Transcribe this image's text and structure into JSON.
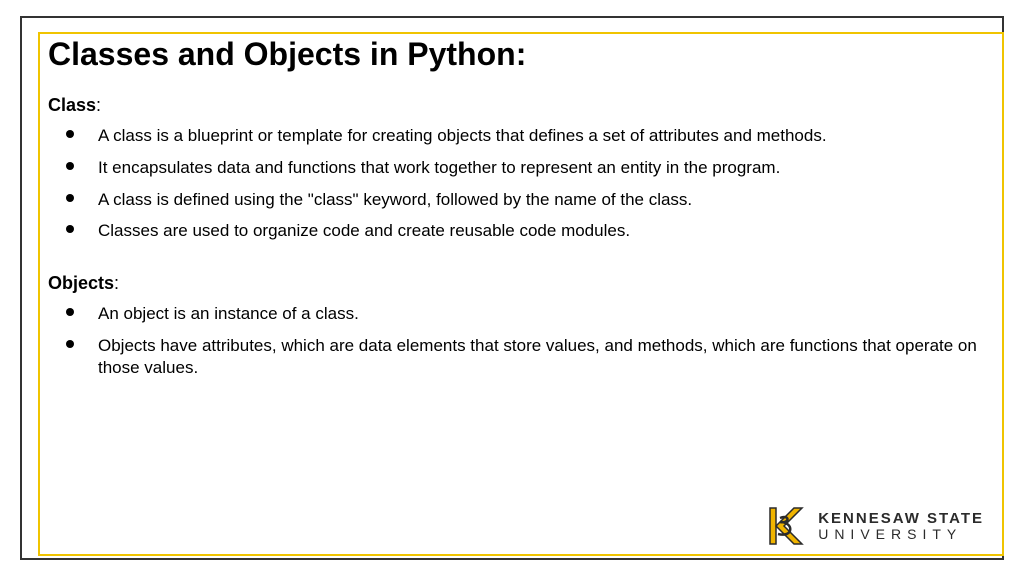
{
  "title": "Classes and Objects in Python:",
  "sections": [
    {
      "label_bold": "Class",
      "label_suffix": ":",
      "bullets": [
        "A class is a blueprint or template for creating objects that defines a set of attributes and methods.",
        "It encapsulates data and functions that work together to represent an entity in the program.",
        "A class is defined using the \"class\" keyword, followed by the name of the class.",
        "Classes are used to organize code and create reusable code modules."
      ]
    },
    {
      "label_bold": "Objects",
      "label_suffix": ":",
      "bullets": [
        "An object is an instance of a class.",
        "Objects have attributes, which are data elements that store values, and methods, which are functions that operate on those values."
      ]
    }
  ],
  "logo": {
    "line1": "KENNESAW STATE",
    "line2": "UNIVERSITY"
  }
}
